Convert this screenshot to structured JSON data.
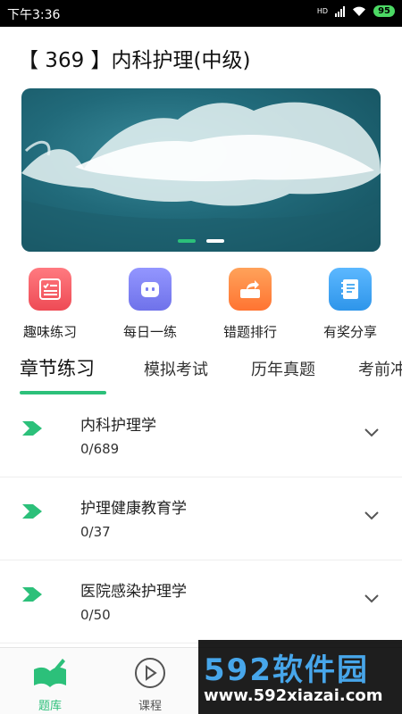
{
  "status_bar": {
    "time": "下午3:36",
    "battery": "95",
    "network": "HD"
  },
  "page_title": "【 369 】内科护理(中级)",
  "banner": {
    "image": "ocean-wave-aerial",
    "pagination": {
      "total": 2,
      "active": 0
    }
  },
  "quick_actions": [
    {
      "label": "趣味练习",
      "icon": "checklist-icon",
      "color": "#f25b63"
    },
    {
      "label": "每日一练",
      "icon": "robot-face-icon",
      "color": "#7c7ff2"
    },
    {
      "label": "错题排行",
      "icon": "share-box-icon",
      "color": "#ff8a3d"
    },
    {
      "label": "有奖分享",
      "icon": "notebook-icon",
      "color": "#3ba4f0"
    }
  ],
  "tabs": [
    {
      "label": "章节练习",
      "active": true
    },
    {
      "label": "模拟考试",
      "active": false
    },
    {
      "label": "历年真题",
      "active": false
    },
    {
      "label": "考前冲",
      "active": false
    }
  ],
  "chapters": [
    {
      "name": "内科护理学",
      "progress": "0/689"
    },
    {
      "name": "护理健康教育学",
      "progress": "0/37"
    },
    {
      "name": "医院感染护理学",
      "progress": "0/50"
    }
  ],
  "bottom_nav": [
    {
      "label": "题库",
      "icon": "book-pen-icon",
      "active": true,
      "color": "#2cc07a"
    },
    {
      "label": "课程",
      "icon": "play-circle-icon",
      "active": false,
      "color": "#555555"
    }
  ],
  "watermark": {
    "brand": "592软件园",
    "url": "www.592xiazai.com"
  }
}
